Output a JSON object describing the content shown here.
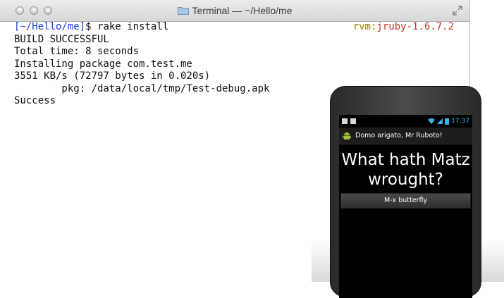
{
  "terminal": {
    "title": "Terminal — ~/Hello/me",
    "prompt_path": "[~/Hello/me]",
    "prompt_cmd": "$ rake install",
    "rvm_label": "rvm:",
    "rvm_version": "jruby-1.6.7.2",
    "output": [
      "BUILD SUCCESSFUL",
      "Total time: 8 seconds",
      "Installing package com.test.me",
      "3551 KB/s (72797 bytes in 0.020s)",
      "        pkg: /data/local/tmp/Test-debug.apk",
      "Success"
    ]
  },
  "phone": {
    "status_time": "17:37",
    "app_title": "Domo arigato, Mr Ruboto!",
    "headline": "What hath Matz wrought?",
    "button_label": "M-x butterfly"
  },
  "colors": {
    "prompt_path": "#1f3fd8",
    "rvm_label": "#9c7d00",
    "rvm_version": "#c0392b",
    "holo_blue": "#33b5e5"
  },
  "icons": [
    "folder-icon",
    "fullscreen-icon",
    "android-icon",
    "wifi-icon",
    "signal-icon",
    "battery-icon"
  ]
}
